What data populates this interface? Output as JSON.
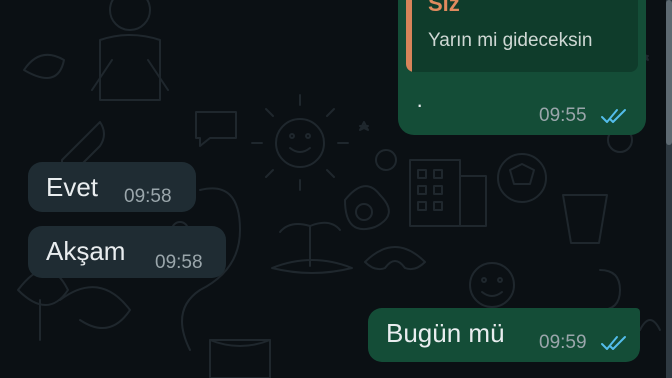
{
  "messages": [
    {
      "id": "reply",
      "direction": "outgoing",
      "quoted": {
        "author": "Siz",
        "text": "Yarın mi gideceksin"
      },
      "text": "·",
      "time": "09:55",
      "status": "read"
    },
    {
      "id": "evet",
      "direction": "incoming",
      "text": "Evet",
      "time": "09:58"
    },
    {
      "id": "aksam",
      "direction": "incoming",
      "text": "Akşam",
      "time": "09:58"
    },
    {
      "id": "bugun",
      "direction": "outgoing",
      "text": "Bugün mü",
      "time": "09:59",
      "status": "read"
    }
  ],
  "colors": {
    "background": "#0b1014",
    "outgoing_bubble": "#144d37",
    "incoming_bubble": "#1f2c33",
    "quote_accent": "#d8845a",
    "read_ticks": "#53bdeb"
  },
  "icons": {
    "read_receipt": "double-check-icon"
  }
}
